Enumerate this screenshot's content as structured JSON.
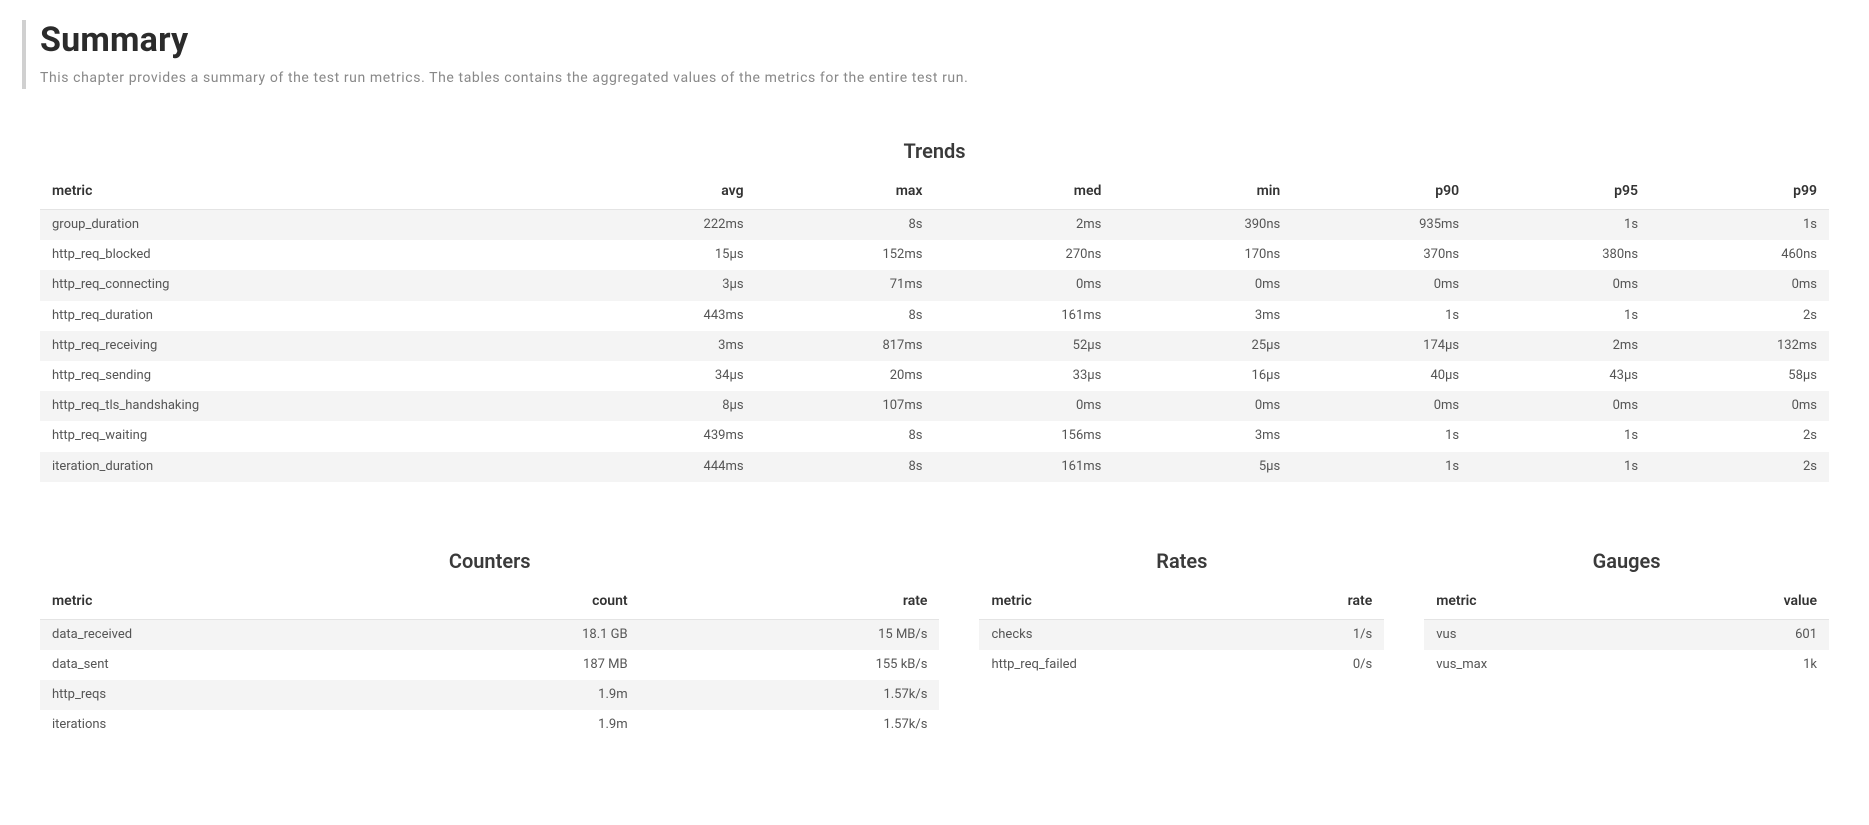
{
  "title": "Summary",
  "subtitle": "This chapter provides a summary of the test run metrics. The tables contains the aggregated values of the metrics for the entire test run.",
  "trends": {
    "heading": "Trends",
    "columns": [
      "metric",
      "avg",
      "max",
      "med",
      "min",
      "p90",
      "p95",
      "p99"
    ],
    "rows": [
      {
        "metric": "group_duration",
        "avg": "222ms",
        "max": "8s",
        "med": "2ms",
        "min": "390ns",
        "p90": "935ms",
        "p95": "1s",
        "p99": "1s"
      },
      {
        "metric": "http_req_blocked",
        "avg": "15µs",
        "max": "152ms",
        "med": "270ns",
        "min": "170ns",
        "p90": "370ns",
        "p95": "380ns",
        "p99": "460ns"
      },
      {
        "metric": "http_req_connecting",
        "avg": "3µs",
        "max": "71ms",
        "med": "0ms",
        "min": "0ms",
        "p90": "0ms",
        "p95": "0ms",
        "p99": "0ms"
      },
      {
        "metric": "http_req_duration",
        "avg": "443ms",
        "max": "8s",
        "med": "161ms",
        "min": "3ms",
        "p90": "1s",
        "p95": "1s",
        "p99": "2s"
      },
      {
        "metric": "http_req_receiving",
        "avg": "3ms",
        "max": "817ms",
        "med": "52µs",
        "min": "25µs",
        "p90": "174µs",
        "p95": "2ms",
        "p99": "132ms"
      },
      {
        "metric": "http_req_sending",
        "avg": "34µs",
        "max": "20ms",
        "med": "33µs",
        "min": "16µs",
        "p90": "40µs",
        "p95": "43µs",
        "p99": "58µs"
      },
      {
        "metric": "http_req_tls_handshaking",
        "avg": "8µs",
        "max": "107ms",
        "med": "0ms",
        "min": "0ms",
        "p90": "0ms",
        "p95": "0ms",
        "p99": "0ms"
      },
      {
        "metric": "http_req_waiting",
        "avg": "439ms",
        "max": "8s",
        "med": "156ms",
        "min": "3ms",
        "p90": "1s",
        "p95": "1s",
        "p99": "2s"
      },
      {
        "metric": "iteration_duration",
        "avg": "444ms",
        "max": "8s",
        "med": "161ms",
        "min": "5µs",
        "p90": "1s",
        "p95": "1s",
        "p99": "2s"
      }
    ]
  },
  "counters": {
    "heading": "Counters",
    "columns": [
      "metric",
      "count",
      "rate"
    ],
    "rows": [
      {
        "metric": "data_received",
        "count": "18.1 GB",
        "rate": "15 MB/s"
      },
      {
        "metric": "data_sent",
        "count": "187 MB",
        "rate": "155 kB/s"
      },
      {
        "metric": "http_reqs",
        "count": "1.9m",
        "rate": "1.57k/s"
      },
      {
        "metric": "iterations",
        "count": "1.9m",
        "rate": "1.57k/s"
      }
    ]
  },
  "rates": {
    "heading": "Rates",
    "columns": [
      "metric",
      "rate"
    ],
    "rows": [
      {
        "metric": "checks",
        "rate": "1/s"
      },
      {
        "metric": "http_req_failed",
        "rate": "0/s"
      }
    ]
  },
  "gauges": {
    "heading": "Gauges",
    "columns": [
      "metric",
      "value"
    ],
    "rows": [
      {
        "metric": "vus",
        "value": "601"
      },
      {
        "metric": "vus_max",
        "value": "1k"
      }
    ]
  }
}
